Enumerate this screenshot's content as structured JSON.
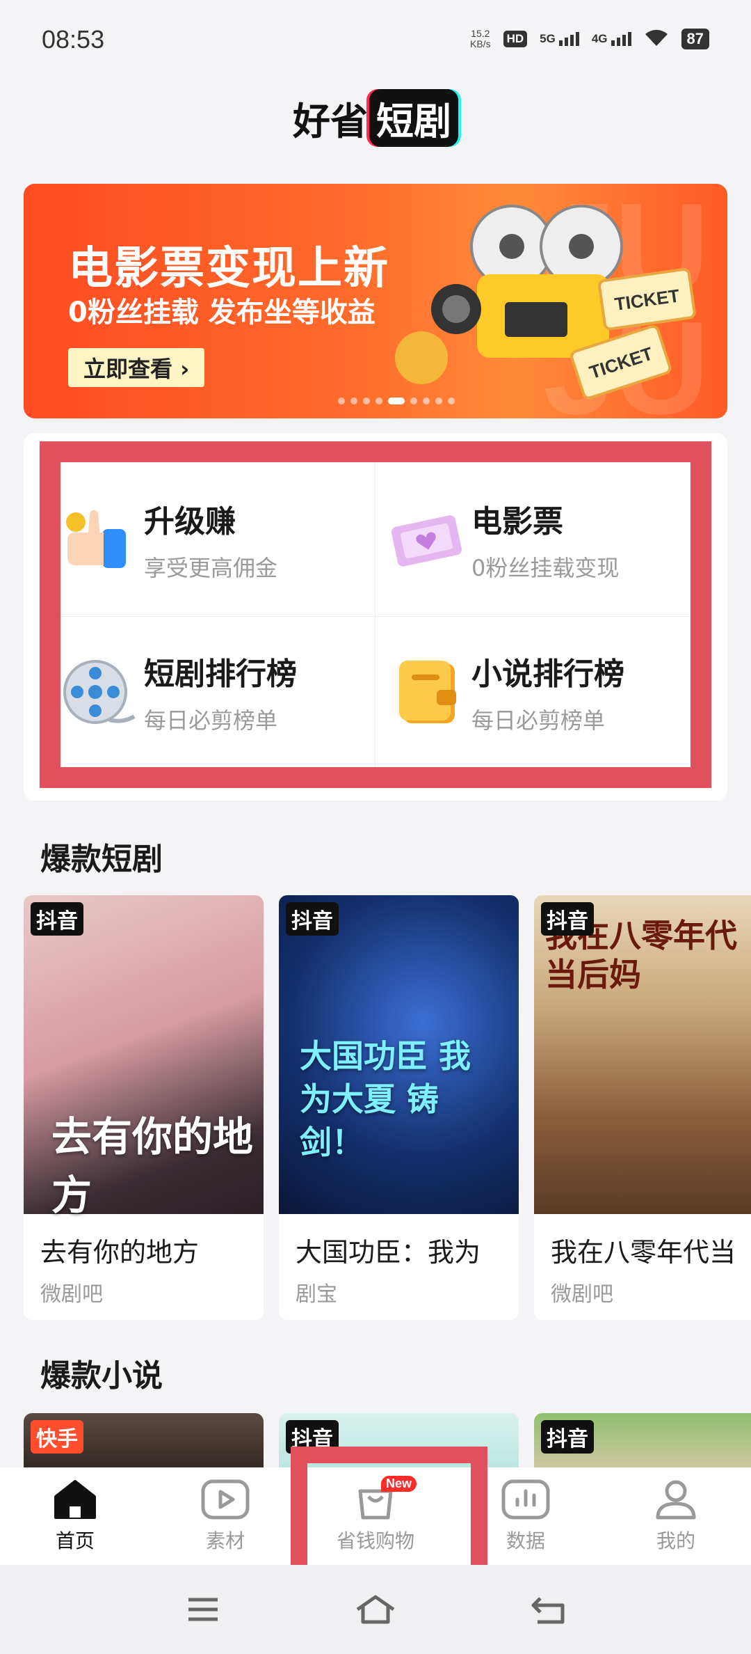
{
  "status_bar": {
    "time": "08:53",
    "net_speed_value": "15.2",
    "net_speed_unit": "KB/s",
    "hd_label": "HD",
    "net1": "5G",
    "net2": "4G",
    "battery": "87"
  },
  "header": {
    "logo_part1": "好省",
    "logo_part2": "短剧"
  },
  "banner": {
    "title": "电影票变现上新",
    "subtitle": "0粉丝挂载 发布坐等收益",
    "button": "立即查看 ›",
    "ticket_label": "TICKET",
    "dots_count": 9,
    "active_dot": 4
  },
  "features": [
    {
      "title": "升级赚",
      "subtitle": "享受更高佣金",
      "icon": "thumbs-up-icon"
    },
    {
      "title": "电影票",
      "subtitle": "0粉丝挂载变现",
      "icon": "ticket-icon"
    },
    {
      "title": "短剧排行榜",
      "subtitle": "每日必剪榜单",
      "icon": "film-reel-icon"
    },
    {
      "title": "小说排行榜",
      "subtitle": "每日必剪榜单",
      "icon": "book-icon"
    }
  ],
  "drama_section": {
    "title": "爆款短剧",
    "items": [
      {
        "platform": "抖音",
        "name": "去有你的地方",
        "source": "微剧吧",
        "poster_text": "去有你的地方"
      },
      {
        "platform": "抖音",
        "name": "大国功臣：我为",
        "source": "剧宝",
        "poster_text": "大国功臣 我为大夏 铸剑！"
      },
      {
        "platform": "抖音",
        "name": "我在八零年代当",
        "source": "微剧吧",
        "poster_text": "我在八零年代当后妈"
      }
    ]
  },
  "novel_section": {
    "title": "爆款小说",
    "items": [
      {
        "platform": "快手"
      },
      {
        "platform": "抖音"
      },
      {
        "platform": "抖音"
      }
    ]
  },
  "bottom_nav": {
    "items": [
      {
        "label": "首页",
        "icon": "home-icon",
        "active": true
      },
      {
        "label": "素材",
        "icon": "play-icon",
        "active": false
      },
      {
        "label": "省钱购物",
        "icon": "shopping-bag-icon",
        "active": false,
        "badge": "New"
      },
      {
        "label": "数据",
        "icon": "chart-icon",
        "active": false
      },
      {
        "label": "我的",
        "icon": "user-icon",
        "active": false
      }
    ]
  },
  "colors": {
    "accent": "#ff4b22",
    "highlight_outline": "#e0505d",
    "badge": "#ff2a2a"
  }
}
